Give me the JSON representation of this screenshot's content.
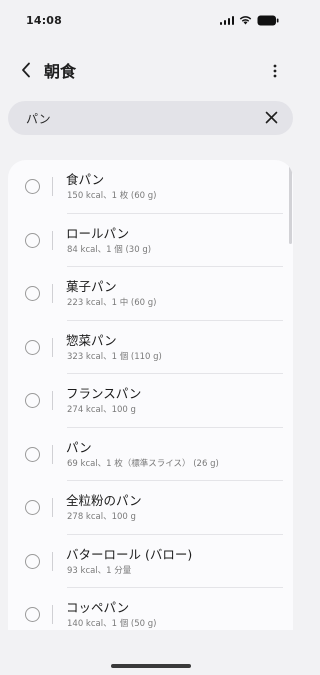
{
  "status_bar": {
    "time": "14:08",
    "icons": [
      "signal-icon",
      "wifi-icon",
      "battery-icon"
    ]
  },
  "header": {
    "title": "朝食",
    "back_icon": "chevron-left-icon",
    "more_icon": "more-vertical-icon"
  },
  "search": {
    "value": "パン",
    "clear_icon": "close-icon"
  },
  "items": [
    {
      "name": "食パン",
      "detail": "150 kcal、1 枚 (60 g)"
    },
    {
      "name": "ロールパン",
      "detail": "84 kcal、1 個 (30 g)"
    },
    {
      "name": "菓子パン",
      "detail": "223 kcal、1 中 (60 g)"
    },
    {
      "name": "惣菜パン",
      "detail": "323 kcal、1 個 (110 g)"
    },
    {
      "name": "フランスパン",
      "detail": "274 kcal、100 g"
    },
    {
      "name": "パン",
      "detail": "69 kcal、1 枚（標準スライス） (26 g)"
    },
    {
      "name": "全粒粉のパン",
      "detail": "278 kcal、100 g"
    },
    {
      "name": "バターロール (バロー)",
      "detail": "93 kcal、1 分量"
    },
    {
      "name": "コッペパン",
      "detail": "140 kcal、1 個 (50 g)"
    }
  ],
  "colors": {
    "background": "#f2f2f4",
    "card": "#fbfbfd",
    "search_bg": "#e3e3e8",
    "text_primary": "#1c1c1c",
    "text_secondary": "#7a7a7a"
  }
}
